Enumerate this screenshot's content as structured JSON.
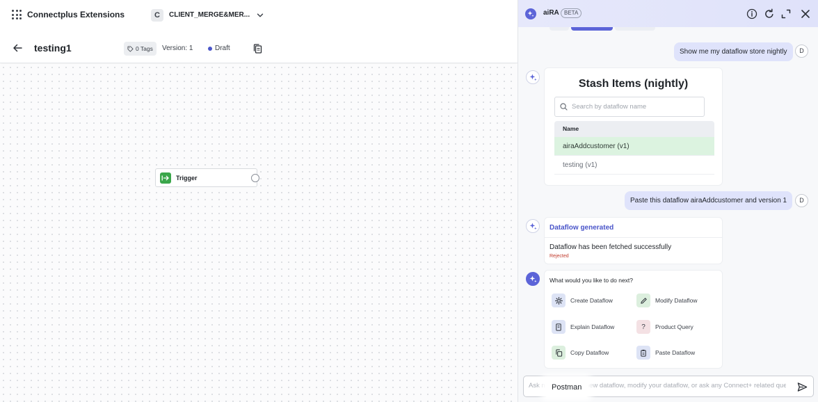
{
  "app": {
    "title": "Connectplus Extensions",
    "client_initial": "C",
    "client_name": "CLIENT_MERGE&MER..."
  },
  "flow": {
    "title": "testing1",
    "tags_label": "0 Tags",
    "version_label": "Version: 1",
    "status": "Draft",
    "status_color": "#4a55c9"
  },
  "canvas": {
    "trigger_label": "Trigger",
    "trigger_color": "#3aa64a"
  },
  "aira": {
    "name": "aiRA",
    "badge": "BETA",
    "accent": "#5c64d8",
    "user_initial": "D",
    "messages": {
      "user_1": "Show me my dataflow store nightly",
      "stash": {
        "title": "Stash Items (nightly)",
        "search_placeholder": "Search by dataflow name",
        "column_header": "Name",
        "rows": [
          "airaAddcustomer (v1)",
          "testing (v1)"
        ],
        "selected_row": "airaAddcustomer (v1)"
      },
      "user_2": "Paste this dataflow airaAddcustomer and version 1",
      "generated": {
        "title": "Dataflow generated",
        "message": "Dataflow has been fetched successfully",
        "status": "Rejected"
      },
      "next": {
        "question": "What would you like to do next?",
        "actions": [
          {
            "label": "Create Dataflow",
            "icon": "gear-icon"
          },
          {
            "label": "Modify Dataflow",
            "icon": "pencil-icon"
          },
          {
            "label": "Explain Dataflow",
            "icon": "document-icon"
          },
          {
            "label": "Product Query",
            "icon": "question-icon"
          },
          {
            "label": "Copy Dataflow",
            "icon": "copy-icon"
          },
          {
            "label": "Paste Dataflow",
            "icon": "clipboard-icon"
          }
        ]
      }
    },
    "composer": {
      "placeholder": "Ask me to create a new dataflow, modify your dataflow, or ask any Connect+ related question",
      "tooltip": "Postman"
    }
  }
}
